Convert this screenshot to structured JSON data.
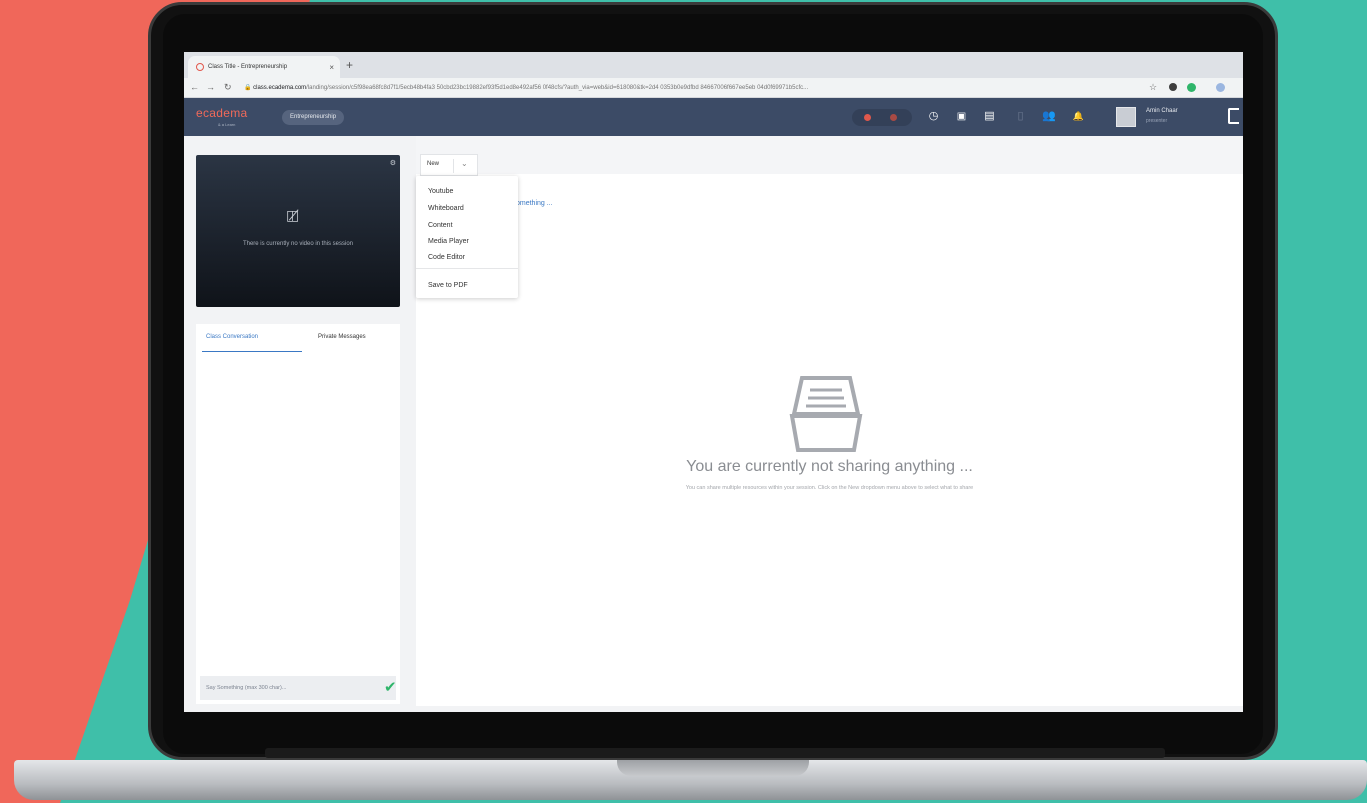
{
  "browser": {
    "tab_title": "Class Title - Entrepreneurship",
    "tab_close": "×",
    "new_tab": "+",
    "url_host": "class.ecadema.com",
    "url_path": "/landing/session/c5f98ea68fc8d7f1/5ecb48b4fa3 50cbd23bc19882ef93f5d1ed8e492af56 0f48cfs/?auth_via=web&id=618080&tk=2d4 0353b0e9dfbd 84667006f667ee5eb 04d0f69971b5cfc..."
  },
  "app": {
    "logo": "ecadema",
    "logo_sub": "& a Learn",
    "course_pill": "Entrepreneurship",
    "user": {
      "name": "Amin Chaar",
      "role": "presenter"
    },
    "colors": {
      "header": "#3c4b66",
      "accent": "#3a78c4",
      "logo": "#f06a5a",
      "check": "#2fb56a"
    }
  },
  "video": {
    "icon": "video-off-icon",
    "message": "There is currently no video in this session"
  },
  "chat": {
    "tabs": [
      "Class Conversation",
      "Private Messages"
    ],
    "input_placeholder": "Say Something (max 300 char)..."
  },
  "share": {
    "new_label": "New",
    "menu_items": [
      "Youtube",
      "Whiteboard",
      "Content",
      "Media Player",
      "Code Editor"
    ],
    "menu_extra": "Save to PDF",
    "partial_text": "omething ...",
    "empty_title": "You are currently not sharing anything ...",
    "empty_subtitle": "You can share multiple resources within your session. Click on the New dropdown menu above to select what to share"
  }
}
